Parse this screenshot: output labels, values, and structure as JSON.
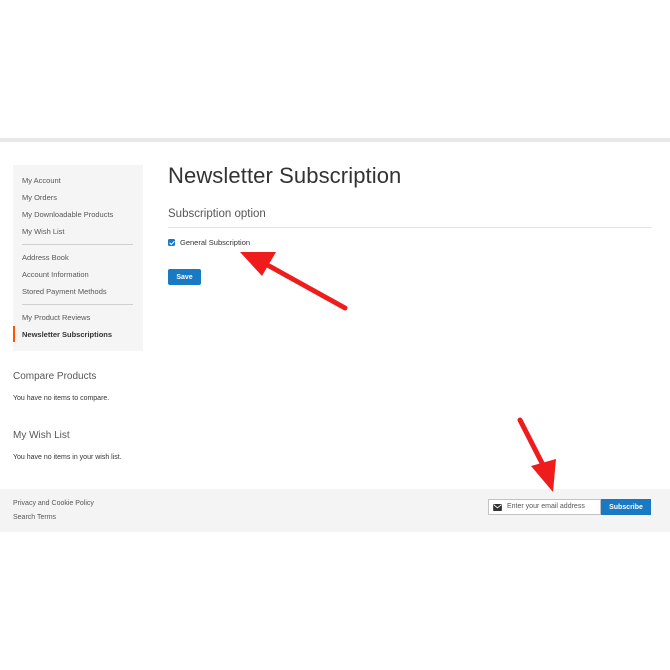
{
  "sidebar": {
    "items": [
      {
        "label": "My Account"
      },
      {
        "label": "My Orders"
      },
      {
        "label": "My Downloadable Products"
      },
      {
        "label": "My Wish List"
      },
      {
        "label": "Address Book"
      },
      {
        "label": "Account Information"
      },
      {
        "label": "Stored Payment Methods"
      },
      {
        "label": "My Product Reviews"
      },
      {
        "label": "Newsletter Subscriptions"
      }
    ],
    "active": "Newsletter Subscriptions"
  },
  "compare": {
    "title": "Compare Products",
    "text": "You have no items to compare."
  },
  "wishlist": {
    "title": "My Wish List",
    "text": "You have no items in your wish list."
  },
  "main": {
    "title": "Newsletter Subscription",
    "legend": "Subscription option",
    "checkbox_label": "General Subscription",
    "checkbox_checked": true,
    "save_label": "Save"
  },
  "footer": {
    "links": [
      "Privacy and Cookie Policy",
      "Search Terms"
    ],
    "newsletter": {
      "placeholder": "Enter your email address",
      "button": "Subscribe"
    }
  },
  "colors": {
    "accent": "#1979c3",
    "active_marker": "#ff5501",
    "annotation_arrow": "#ee1c1c"
  },
  "icons": {
    "email_field": "envelope-icon",
    "checkbox": "checkmark-icon"
  }
}
